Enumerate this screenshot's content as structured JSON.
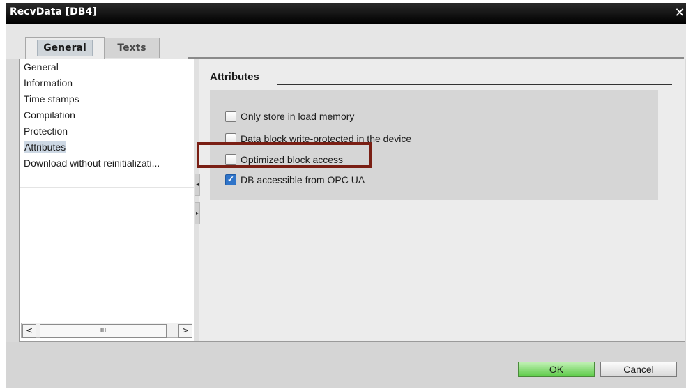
{
  "window": {
    "title": "RecvData [DB4]",
    "close_glyph": "✕"
  },
  "tabs": [
    {
      "label": "General",
      "active": true
    },
    {
      "label": "Texts",
      "active": false
    }
  ],
  "nav": {
    "items": [
      {
        "label": "General",
        "selected": false
      },
      {
        "label": "Information",
        "selected": false
      },
      {
        "label": "Time stamps",
        "selected": false
      },
      {
        "label": "Compilation",
        "selected": false
      },
      {
        "label": "Protection",
        "selected": false
      },
      {
        "label": "Attributes",
        "selected": true
      },
      {
        "label": "Download without reinitializati...",
        "selected": false
      }
    ],
    "scroll_left": "<",
    "scroll_right": ">",
    "scroll_thumb_grip": "III"
  },
  "section": {
    "title": "Attributes"
  },
  "attributes": [
    {
      "label": "Only store in load memory",
      "checked": false
    },
    {
      "label": "Data block write-protected in the device",
      "checked": false
    },
    {
      "label": "Optimized block access",
      "checked": false
    },
    {
      "label": "DB accessible from OPC UA",
      "checked": true
    }
  ],
  "footer": {
    "ok_label": "OK",
    "cancel_label": "Cancel"
  },
  "colors": {
    "title_bar": "#000000",
    "ok_button": "#5ecb49",
    "highlight_border": "#7a1f14",
    "checkbox_checked": "#2f74c9",
    "nav_selected": "#cdd8e4"
  }
}
